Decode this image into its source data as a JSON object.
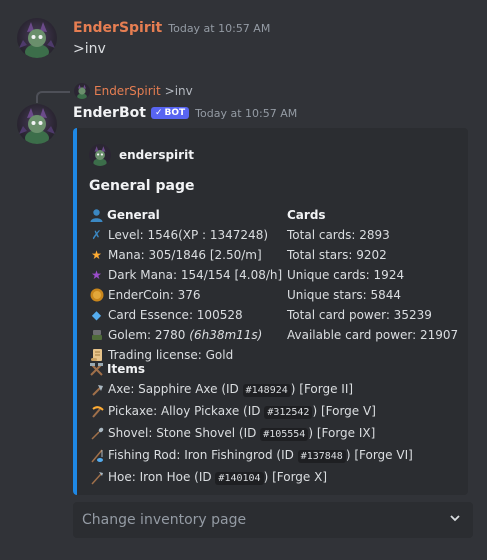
{
  "message1": {
    "author": "EnderSpirit",
    "author_color": "#e67e52",
    "timestamp": "Today at 10:57 AM",
    "content": ">inv"
  },
  "reply": {
    "author": "EnderSpirit",
    "content": ">inv"
  },
  "message2": {
    "author": "EnderBot",
    "bot_tag": "BOT",
    "timestamp": "Today at 10:57 AM"
  },
  "embed": {
    "accent_color": "#1e88e5",
    "author": "enderspirit",
    "title": "General page",
    "general": {
      "name": "General",
      "icon": "person-icon",
      "level": "Level: 1546(XP : 1347248)",
      "mana": "Mana: 305/1846 [2.50/m]",
      "dark_mana": "Dark Mana: 154/154 [4.08/h]",
      "endercoin": "EnderCoin: 376",
      "card_essence": "Card Essence: 100528",
      "golem_prefix": "Golem: 2780 ",
      "golem_time": "(6h38m11s)",
      "trading": "Trading license: Gold"
    },
    "cards": {
      "name": "Cards",
      "total_cards": "Total cards: 2893",
      "total_stars": "Total stars: 9202",
      "unique_cards": "Unique cards: 1924",
      "unique_stars": "Unique stars: 5844",
      "total_power": "Total card power: 35239",
      "available_power": "Available card power: 21907"
    },
    "items": {
      "name": "Items",
      "axe": {
        "pre": "Axe: Sapphire Axe (ID ",
        "id": "#148924",
        "post": ") [Forge II]"
      },
      "pickaxe": {
        "pre": "Pickaxe: Alloy Pickaxe (ID ",
        "id": "#312542",
        "post": ") [Forge V]"
      },
      "shovel": {
        "pre": "Shovel: Stone Shovel (ID ",
        "id": "#105554",
        "post": ") [Forge IX]"
      },
      "fishing_rod": {
        "pre": "Fishing Rod: Iron Fishingrod (ID ",
        "id": "#137848",
        "post": ") [Forge VI]"
      },
      "hoe": {
        "pre": "Hoe: Iron Hoe (ID ",
        "id": "#140104",
        "post": ") [Forge X]"
      }
    }
  },
  "select": {
    "placeholder": "Change inventory page"
  }
}
